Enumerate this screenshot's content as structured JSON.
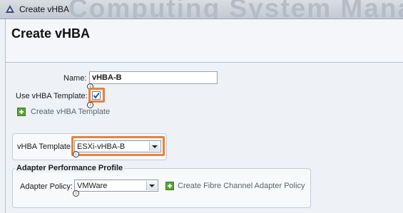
{
  "window": {
    "title": "Create vHBA",
    "watermark": "Computing System Manager"
  },
  "header": {
    "title": "Create vHBA"
  },
  "form": {
    "name_label": "Name:",
    "name_value": "vHBA-B",
    "use_template_label": "Use vHBA Template:",
    "use_template_checked": true,
    "create_template_link": "Create vHBA Template",
    "vhba_template_label": "vHBA Template:",
    "vhba_template_value": "ESXi-vHBA-B"
  },
  "adapter_performance": {
    "legend": "Adapter Performance Profile",
    "policy_label": "Adapter Policy:",
    "policy_value": "VMWare",
    "create_policy_link": "Create Fibre Channel Adapter Policy"
  },
  "colors": {
    "highlight": "#e9823b",
    "add_icon": "#5aa335"
  },
  "icons": {
    "app": "app-triangle-icon",
    "info": "info-icon",
    "add": "plus-icon",
    "dropdown": "chevron-down-icon",
    "check": "checkmark-icon"
  }
}
